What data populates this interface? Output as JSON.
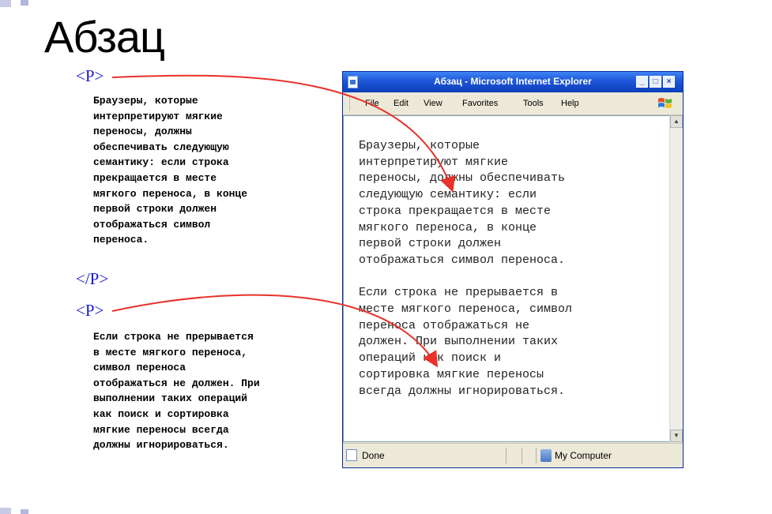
{
  "slide": {
    "title": "Абзац",
    "tag1_open": "<P>",
    "tag1_close": "</P>",
    "tag2_open": "<P>",
    "para1_lines": [
      "Браузеры, которые",
      "интерпретируют мягкие",
      "переносы, должны",
      "обеспечивать следующую",
      "семантику: если строка",
      "прекращается в месте",
      "мягкого переноса, в конце",
      "первой строки должен",
      "отображаться символ",
      "переноса."
    ],
    "para2_lines": [
      "Если строка не прерывается",
      "в месте мягкого переноса,",
      "символ переноса",
      "отображаться не должен. При",
      "выполнении таких операций",
      "как поиск и сортировка",
      "мягкие переносы всегда",
      "должны игнорироваться."
    ]
  },
  "browser": {
    "title": "Абзац - Microsoft Internet Explorer",
    "window_controls": [
      "_",
      "□",
      "×"
    ],
    "menu": [
      "File",
      "Edit",
      "View",
      "Favorites",
      "Tools",
      "Help"
    ],
    "content_lines": [
      "Браузеры, которые",
      "интерпретируют мягкие",
      "переносы, должны обеспечивать",
      "следующую семантику: если",
      "строка прекращается в месте",
      "мягкого переноса, в конце",
      "первой строки должен",
      "отображаться символ переноса.",
      "",
      "Если строка не прерывается в",
      "месте мягкого переноса, символ",
      "переноса отображаться не",
      "должен. При выполнении таких",
      "операций как поиск и",
      "сортировка мягкие переносы",
      "всегда должны игнорироваться."
    ],
    "scroll_up": "▲",
    "scroll_down": "▼",
    "status_left": "Done",
    "status_right": "My Computer"
  },
  "colors": {
    "tag": "#1a1acc",
    "arrow": "#e8322a",
    "titlebar": "#1d56d8"
  },
  "icons": [
    "ie-page-icon",
    "windows-flag-icon",
    "page-done-icon",
    "computer-icon"
  ]
}
